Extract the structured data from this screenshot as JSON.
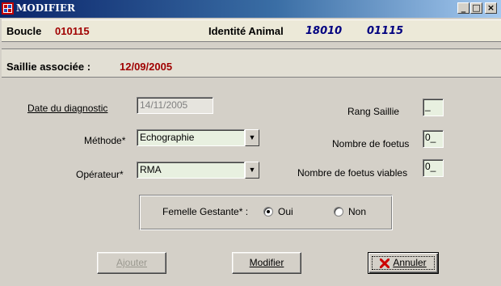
{
  "window": {
    "title": "MODIFIER",
    "controls": [
      "_",
      "□",
      "×"
    ]
  },
  "header": {
    "boucle_label": "Boucle",
    "boucle_value": "010115",
    "identite_label": "Identité Animal",
    "identite_value1": "18010",
    "identite_value2": "01115"
  },
  "saillie": {
    "label": "Saillie associée :",
    "date": "12/09/2005"
  },
  "form": {
    "date_diag_label": "Date du diagnostic",
    "date_diag_value": "14/11/2005",
    "methode_label": "Méthode*",
    "methode_value": "Echographie",
    "operateur_label": "Opérateur*",
    "operateur_value": "RMA",
    "rang_label": "Rang Saillie",
    "rang_value": "_",
    "nb_foetus_label": "Nombre de foetus",
    "nb_foetus_value": "0_",
    "nb_viables_label": "Nombre de foetus viables",
    "nb_viables_value": "0_",
    "gestante_label": "Femelle Gestante* :",
    "oui_label": "Oui",
    "non_label": "Non",
    "gestante_selected": "Oui"
  },
  "buttons": {
    "ajouter": "Ajouter",
    "modifier": "Modifier",
    "annuler": "Annuler"
  },
  "colors": {
    "accent_red": "#a00000",
    "navy": "#000080"
  }
}
